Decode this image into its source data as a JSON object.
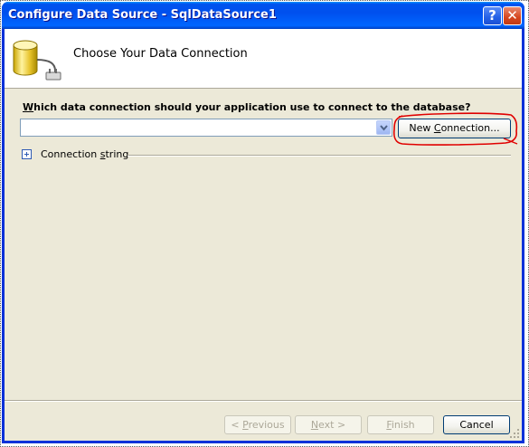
{
  "window": {
    "title": "Configure Data Source - SqlDataSource1",
    "help_glyph": "?",
    "close_glyph": "✕"
  },
  "header": {
    "icon": "database-plug-icon",
    "title": "Choose Your Data Connection"
  },
  "connection": {
    "question_accel": "W",
    "question_rest": "hich data connection should your application use to connect to the database?",
    "selected_value": "",
    "new_connection_prefix": "New ",
    "new_connection_accel": "C",
    "new_connection_rest": "onnection...",
    "connection_string_prefix": "Connection ",
    "connection_string_accel": "s",
    "connection_string_rest": "tring",
    "connection_string_expanded": false
  },
  "footer": {
    "previous_prefix": "< ",
    "previous_accel": "P",
    "previous_rest": "revious",
    "next_accel": "N",
    "next_rest": "ext >",
    "finish_accel": "F",
    "finish_rest": "inish",
    "cancel_label": "Cancel"
  },
  "colors": {
    "titlebar": "#0054e3",
    "client_background": "#ece9d8",
    "highlight_annotation": "#e00000"
  }
}
